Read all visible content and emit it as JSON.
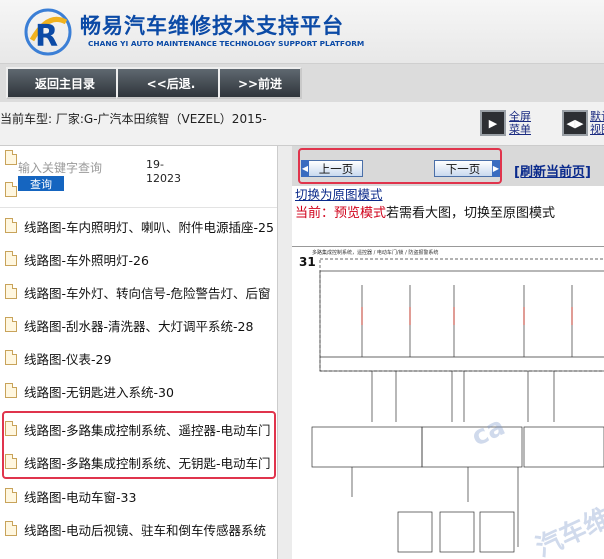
{
  "header": {
    "title_cn": "畅易汽车维修技术支持平台",
    "title_en": "CHANG YI AUTO MAINTENANCE TECHNOLOGY SUPPORT PLATFORM",
    "brand_color": "#0b4aa6"
  },
  "nav": {
    "back_main": "返回主目录",
    "back": "<<后退.",
    "forward": ">>前进"
  },
  "vehicle": {
    "label": "当前车型:  厂家:G-广汽本田缤智（VEZEL）2015-",
    "tool1": "全屏\n菜单",
    "tool2": "默认\n视图"
  },
  "search": {
    "placeholder": "输入关键字查询",
    "button": "查询",
    "date": "19-\n12023"
  },
  "list_items": [
    "线路图-车内照明灯、喇叭、附件电源插座-25",
    "线路图-车外照明灯-26",
    "线路图-车外灯、转向信号-危险警告灯、后窗",
    "线路图-刮水器-清洗器、大灯调平系统-28",
    "线路图-仪表-29",
    "线路图-无钥匙进入系统-30",
    "线路图-多路集成控制系统、遥控器-电动车门",
    "线路图-多路集成控制系统、无钥匙-电动车门",
    "线路图-电动车窗-33",
    "线路图-电动后视镜、驻车和倒车传感器系统"
  ],
  "pager": {
    "prev": "上一页",
    "next": "下一页",
    "refresh": "[刷新当前页]",
    "switch_link": "切换为原图模式",
    "mode_prefix": "当前：预览模式",
    "mode_text": "若需看大图，切换至原图模式"
  },
  "diagram": {
    "page_number": "31",
    "title": "多路集成控制系统，遥控器 / 电动车门/锁 / 防盗报警系统"
  },
  "highlight_color": "#e0344c"
}
